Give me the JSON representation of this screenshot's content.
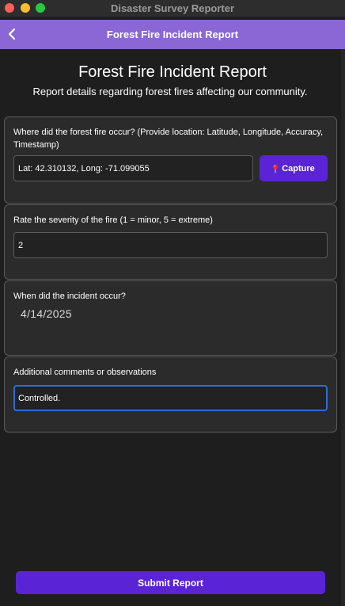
{
  "window": {
    "title": "Disaster Survey Reporter"
  },
  "header": {
    "title": "Forest Fire Incident Report",
    "back_icon": "chevron-left-icon"
  },
  "main": {
    "title": "Forest Fire Incident Report",
    "subtitle": "Report details regarding forest fires affecting our community."
  },
  "location": {
    "label": "Where did the forest fire occur? (Provide location: Latitude, Longitude, Accuracy, Timestamp)",
    "value": "Lat: 42.310132, Long: -71.099055",
    "capture_label": "Capture",
    "capture_icon": "pin-icon"
  },
  "severity": {
    "label": "Rate the severity of the fire (1 = minor, 5 = extreme)",
    "value": "2"
  },
  "incident_date": {
    "label": "When did the incident occur?",
    "value": "4/14/2025"
  },
  "comments": {
    "label": "Additional comments or observations",
    "value": "Controlled."
  },
  "submit": {
    "label": "Submit Report"
  },
  "colors": {
    "header_bg": "#8a67d4",
    "primary_button": "#5a24d6",
    "focus_ring": "#2b6fd6",
    "background": "#1e1e1e",
    "card_bg": "#2b2b2b"
  }
}
